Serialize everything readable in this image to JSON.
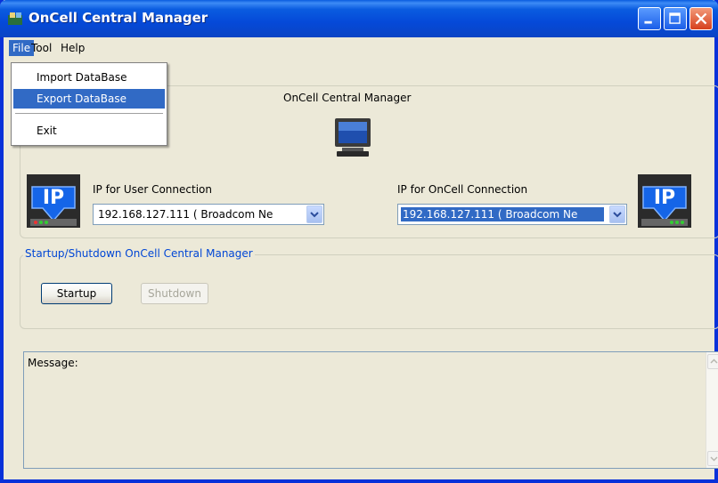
{
  "window": {
    "title": "OnCell Central Manager"
  },
  "menubar": {
    "items": [
      {
        "label": "File",
        "mnemonic": "F"
      },
      {
        "label": "Tool",
        "mnemonic": "T"
      },
      {
        "label": "Help",
        "mnemonic": "H"
      }
    ]
  },
  "file_menu": {
    "items": [
      {
        "label": "Import DataBase"
      },
      {
        "label": "Export DataBase"
      },
      {
        "label": "Exit"
      }
    ]
  },
  "main_group": {
    "title": "OnCell Central Manager",
    "user_connection": {
      "label": "IP for User Connection",
      "value": "192.168.127.111  ( Broadcom Ne"
    },
    "oncell_connection": {
      "label": "IP for OnCell Connection",
      "value": "192.168.127.111  ( Broadcom Ne"
    },
    "icon_text": "IP"
  },
  "startup_group": {
    "legend": "Startup/Shutdown OnCell Central Manager",
    "startup_label": "Startup",
    "shutdown_label": "Shutdown"
  },
  "message": {
    "label": "Message:"
  },
  "colors": {
    "titlebar": "#0a5ce0",
    "selection": "#316ac5",
    "group_title": "#0046d5"
  },
  "icons": [
    "app-icon",
    "minimize-icon",
    "maximize-icon",
    "close-icon",
    "computer-monitor-icon",
    "ip-network-icon",
    "chevron-down-icon",
    "scroll-up-icon",
    "scroll-down-icon"
  ]
}
